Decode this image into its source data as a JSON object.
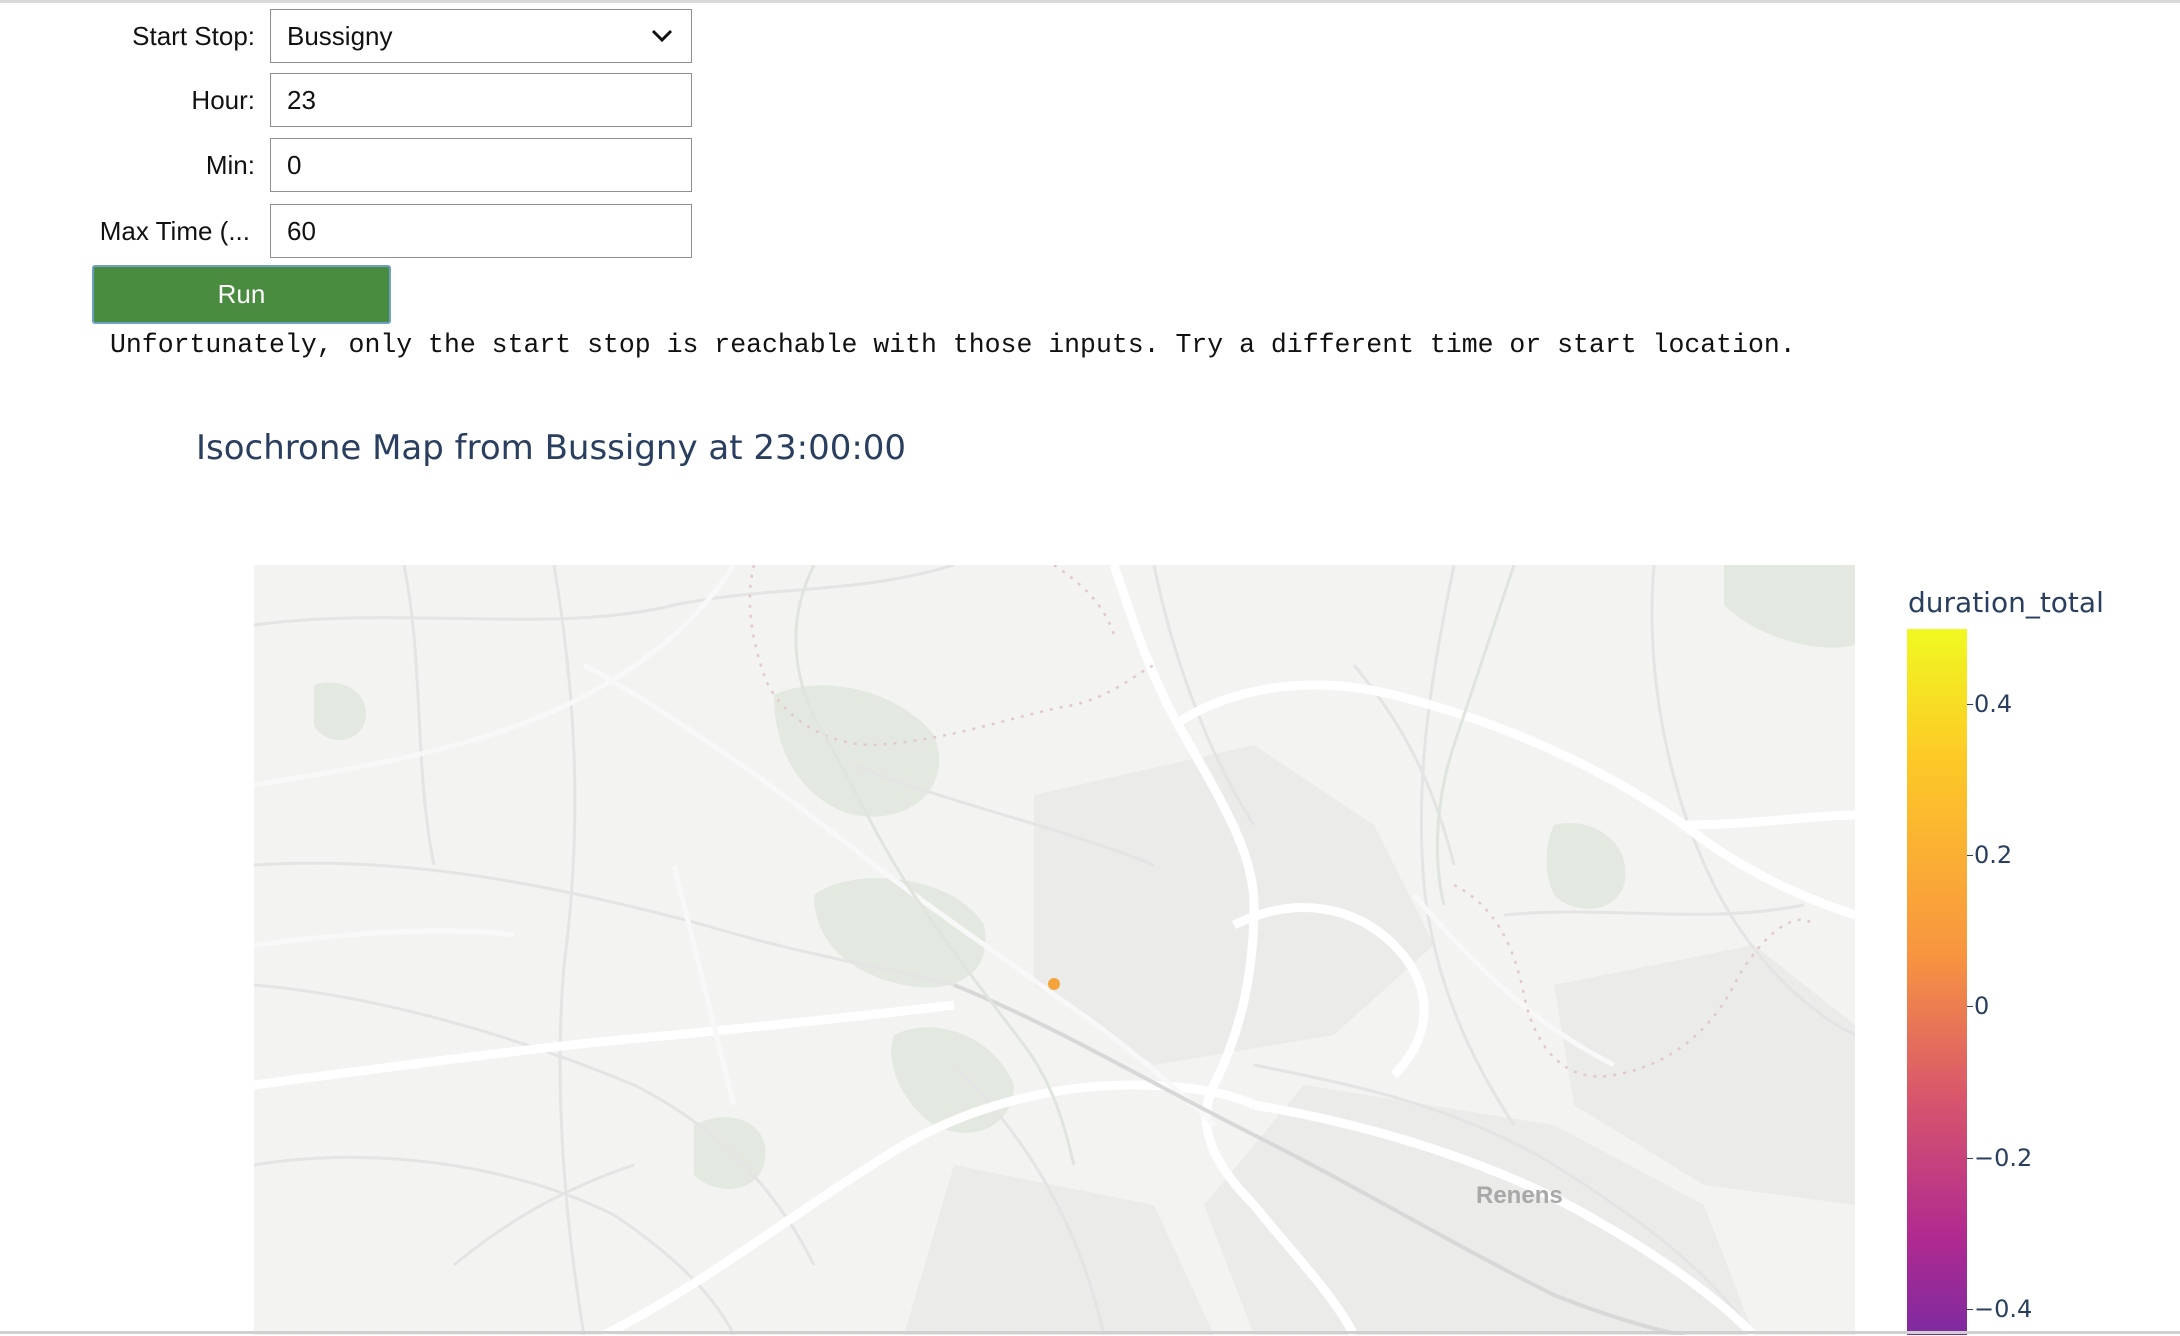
{
  "form": {
    "start_stop": {
      "label": "Start Stop:",
      "value": "Bussigny"
    },
    "hour": {
      "label": "Hour:",
      "value": "23"
    },
    "min": {
      "label": "Min:",
      "value": "0"
    },
    "max_time": {
      "label": "Max Time (...",
      "value": "60"
    },
    "run_label": "Run"
  },
  "message": "Unfortunately, only the start stop is reachable with those inputs. Try a different time or start location.",
  "map": {
    "title": "Isochrone Map from Bussigny at 23:00:00",
    "place_label": "Renens",
    "colorbar": {
      "title": "duration_total",
      "ticks": [
        "0.4",
        "0.2",
        "0",
        "−0.2",
        "−0.4"
      ],
      "colorscale": [
        "#0d0887",
        "#7e03a8",
        "#cc4778",
        "#f89540",
        "#f0f921"
      ]
    },
    "point": {
      "label": "Bussigny",
      "duration_total": 0,
      "color": "#f5a43c"
    }
  }
}
